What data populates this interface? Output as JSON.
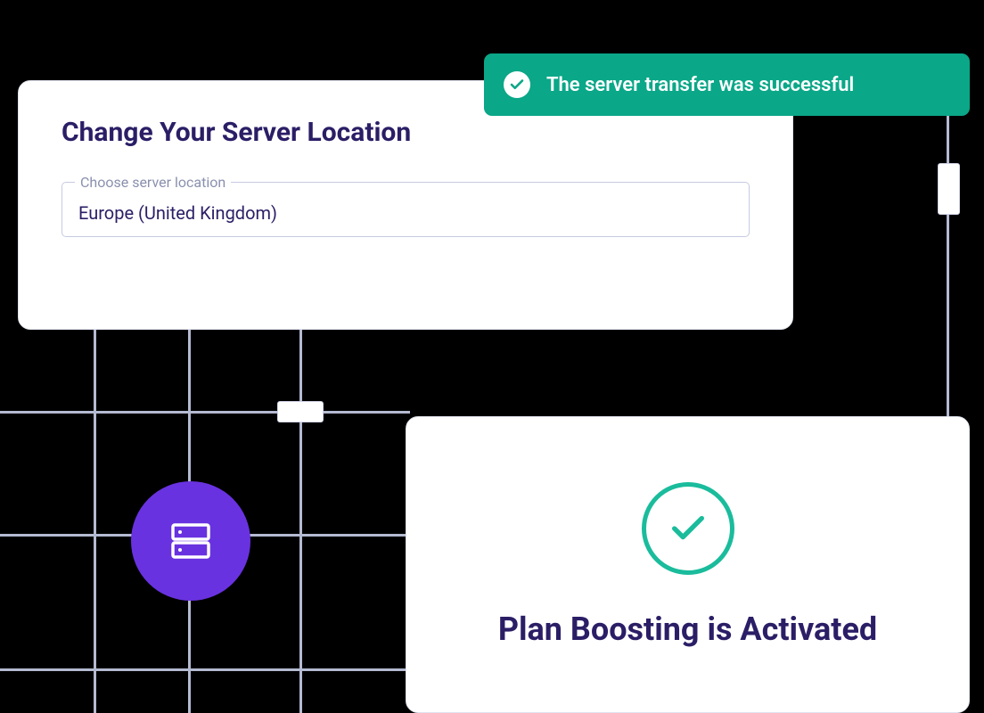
{
  "toast": {
    "message": "The server transfer was successful"
  },
  "serverCard": {
    "title": "Change Your Server Location",
    "selectLabel": "Choose server location",
    "selectValue": "Europe (United Kingdom)"
  },
  "planCard": {
    "title": "Plan Boosting is Activated"
  }
}
